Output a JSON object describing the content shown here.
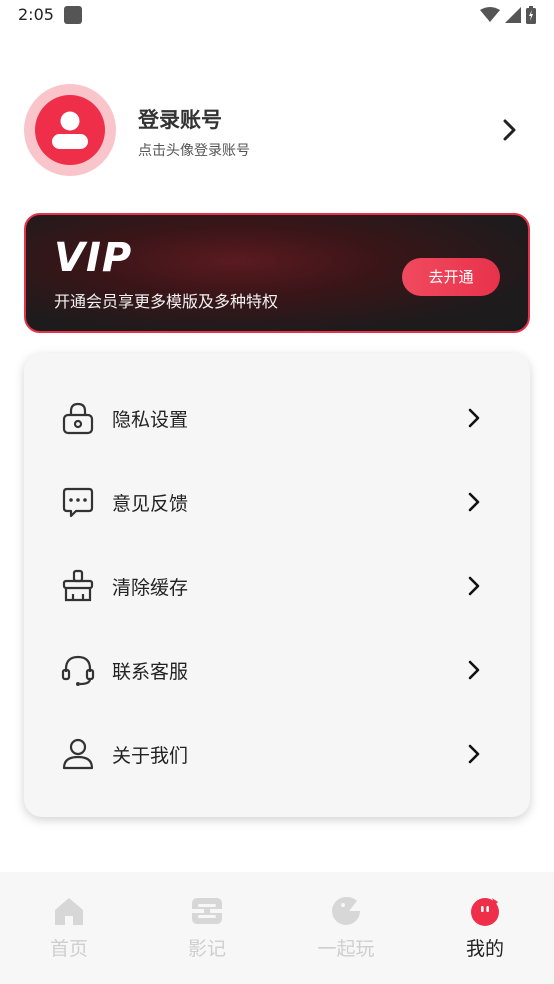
{
  "status_bar": {
    "time": "2:05"
  },
  "profile": {
    "name": "登录账号",
    "subtitle": "点击头像登录账号",
    "avatar_icon": "user-icon",
    "accent_color": "#ef2f4a"
  },
  "vip": {
    "logo_text": "VIP",
    "description": "开通会员享更多模版及多种特权",
    "button_label": "去开通",
    "accent_color": "#e6334a"
  },
  "menu": {
    "items": [
      {
        "label": "隐私设置",
        "icon": "lock-icon"
      },
      {
        "label": "意见反馈",
        "icon": "chat-bubble-icon"
      },
      {
        "label": "清除缓存",
        "icon": "broom-icon"
      },
      {
        "label": "联系客服",
        "icon": "headset-icon"
      },
      {
        "label": "关于我们",
        "icon": "user-outline-icon"
      }
    ]
  },
  "tab_bar": {
    "tabs": [
      {
        "label": "首页",
        "icon": "home-icon",
        "active": false
      },
      {
        "label": "影记",
        "icon": "film-icon",
        "active": false
      },
      {
        "label": "一起玩",
        "icon": "game-icon",
        "active": false
      },
      {
        "label": "我的",
        "icon": "profile-icon",
        "active": true
      }
    ],
    "active_color": "#ef2f4a",
    "inactive_color": "#cfcfcf"
  }
}
